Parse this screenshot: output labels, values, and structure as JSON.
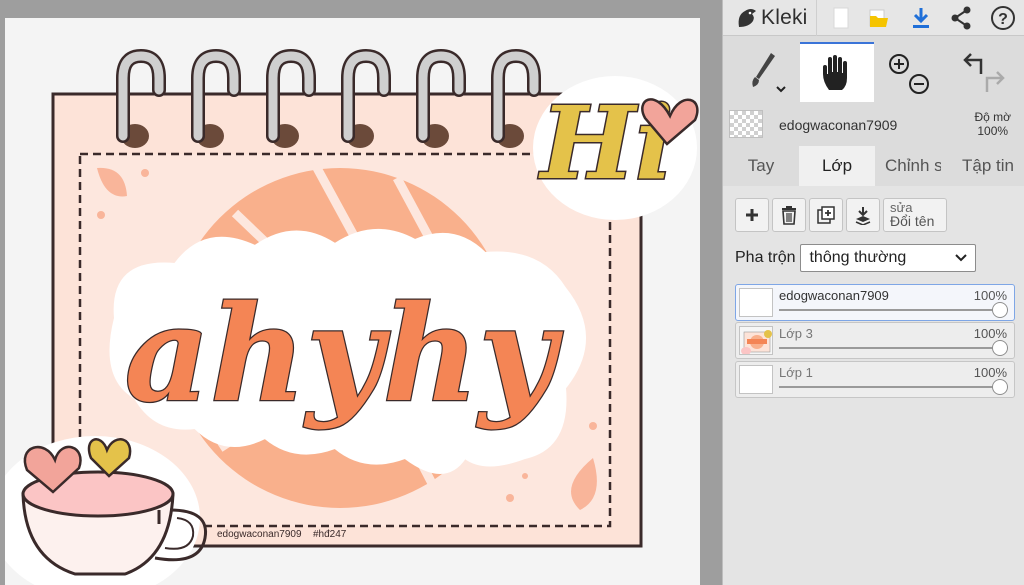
{
  "app": {
    "name": "Kleki",
    "toolbar": {
      "new_icon": "new-file-icon",
      "open_icon": "folder-icon",
      "save_icon": "download-icon",
      "share_icon": "share-icon",
      "help_label": "?"
    }
  },
  "tools": {
    "brush_icon": "brush-icon",
    "hand_icon": "hand-icon",
    "zoom_in_icon": "zoom-in-icon",
    "zoom_out_icon": "zoom-out-icon",
    "undo_icon": "undo-icon",
    "redo_icon": "redo-icon",
    "active_tool": "hand"
  },
  "current_layer": {
    "name": "edogwaconan7909",
    "opacity_label": "Độ mờ",
    "opacity_value": "100%"
  },
  "tabs": [
    {
      "label": "Tay",
      "active": false
    },
    {
      "label": "Lớp",
      "active": true
    },
    {
      "label": "Chỉnh sửa",
      "active": false
    },
    {
      "label": "Tập tin",
      "active": false
    }
  ],
  "layer_actions": {
    "add_icon": "plus-icon",
    "delete_icon": "trash-icon",
    "duplicate_icon": "duplicate-icon",
    "merge_icon": "merge-down-icon",
    "rename_overlap": "sửa",
    "rename_label": "Đổi tên"
  },
  "blend": {
    "label": "Pha trộn",
    "value": "thông thường"
  },
  "layers": [
    {
      "name": "edogwaconan7909",
      "opacity": "100%",
      "selected": true,
      "opacity_fraction": 1.0
    },
    {
      "name": "Lớp 3",
      "opacity": "100%",
      "selected": false,
      "opacity_fraction": 1.0
    },
    {
      "name": "Lớp 1",
      "opacity": "100%",
      "selected": false,
      "opacity_fraction": 1.0
    }
  ],
  "artwork": {
    "title_text": "ahyhy",
    "sticker_text": "Hi",
    "signature": "edogwaconan7909",
    "hashtag": "#hđ247",
    "colors": {
      "calendar_fill": "#fde3d8",
      "circle_fill": "#f9b08c",
      "letter_fill": "#f48555",
      "outline": "#3a2a2a",
      "hi_fill": "#e4c24a",
      "heart_fill": "#f2a49a"
    }
  }
}
